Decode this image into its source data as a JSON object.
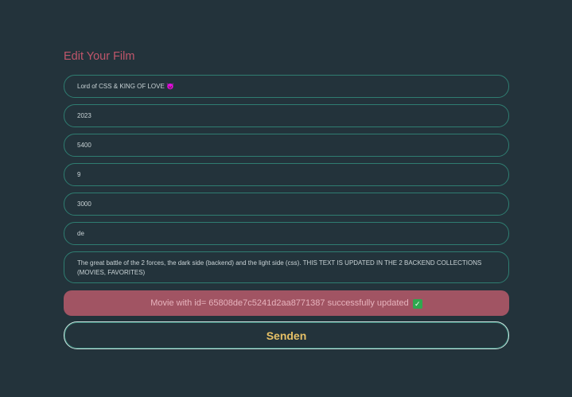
{
  "form": {
    "title": "Edit Your Film",
    "fields": {
      "title": "Lord of CSS & KING OF LOVE 😈",
      "year": "2023",
      "duration": "5400",
      "rating": "9",
      "budget": "3000",
      "language": "de",
      "description": "The great battle of the 2 forces, the dark side (backend) and the light side (css). THIS TEXT IS UPDATED IN THE 2 BACKEND COLLECTIONS (MOVIES, FAVORITES)"
    },
    "status_message": "Movie with id= 65808de7c5241d2aa8771387 successfully updated",
    "status_icon": "✓",
    "submit_label": "Senden"
  }
}
